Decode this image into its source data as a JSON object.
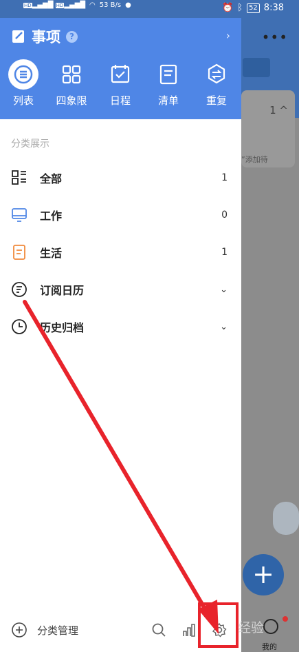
{
  "status_bar": {
    "net_speed": "53 B/s",
    "battery": "52",
    "time": "8:38"
  },
  "drawer": {
    "title": "事项",
    "help": "?",
    "expand": "›",
    "nav": [
      {
        "label": "列表",
        "icon": "list-circle-icon",
        "active": true
      },
      {
        "label": "四象限",
        "icon": "grid-icon"
      },
      {
        "label": "日程",
        "icon": "calendar-check-icon"
      },
      {
        "label": "清单",
        "icon": "document-list-icon"
      },
      {
        "label": "重复",
        "icon": "repeat-icon"
      }
    ],
    "section_title": "分类展示",
    "categories": [
      {
        "label": "全部",
        "count": "1",
        "icon": "all-grid-icon"
      },
      {
        "label": "工作",
        "count": "0",
        "icon": "monitor-icon",
        "color": "#4f86e6"
      },
      {
        "label": "生活",
        "count": "1",
        "icon": "notebook-icon",
        "color": "#f08a3c"
      },
      {
        "label": "订阅日历",
        "chevron": "⌄",
        "icon": "subscribe-calendar-icon"
      },
      {
        "label": "历史归档",
        "chevron": "⌄",
        "icon": "clock-icon"
      }
    ],
    "footer": {
      "manage_label": "分类管理"
    }
  },
  "background": {
    "more": "•••",
    "card_count": "1 ^",
    "card_text": "”添加待",
    "fab": "+",
    "me_label": "我的"
  },
  "annotation": {
    "watermark": "经验",
    "arrow_color": "#e8232b",
    "box_color": "#e8232b"
  }
}
